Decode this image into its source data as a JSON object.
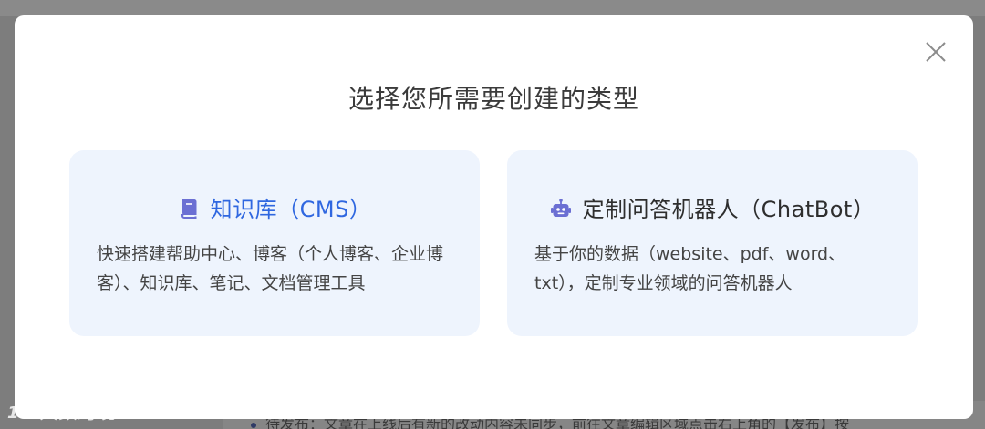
{
  "background": {
    "bottom_text": "待发布：文章在上线后有新的改动内容未同步，前往文章编辑区域点击右上角的【发布】按"
  },
  "watermark": {
    "logo_text": "1⁰⁰",
    "text": "大数跨境"
  },
  "modal": {
    "title": "选择您所需要创建的类型",
    "close_icon": "close-icon",
    "cards": [
      {
        "icon": "book-icon",
        "title": "知识库（CMS）",
        "description": "快速搭建帮助中心、博客（个人博客、企业博客）、知识库、笔记、文档管理工具"
      },
      {
        "icon": "robot-icon",
        "title": "定制问答机器人（ChatBot）",
        "description": "基于你的数据（website、pdf、word、txt），定制专业领域的问答机器人"
      }
    ]
  },
  "colors": {
    "overlay": "#7d7d7d",
    "card_bg": "#eef4fd",
    "accent_blue": "#2f67e0",
    "icon_purple": "#6b6fd3",
    "title_text": "#3b3b3b"
  }
}
